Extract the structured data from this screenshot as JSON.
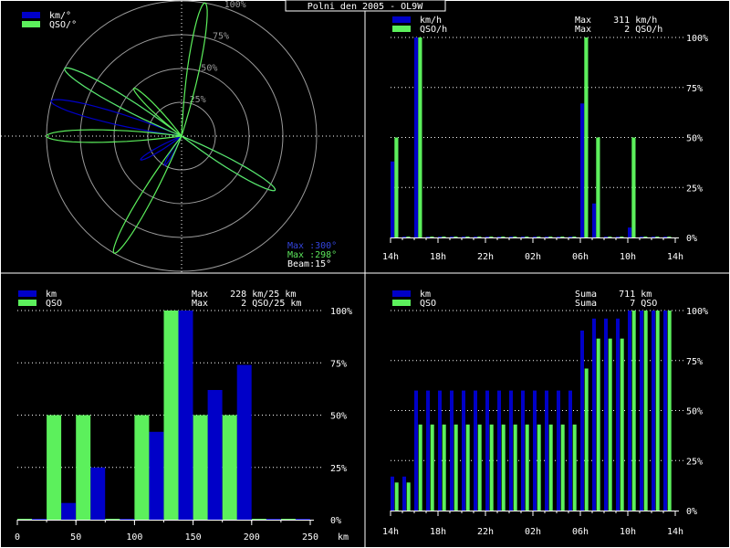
{
  "title": "Polni den 2005 - OL9W",
  "colors": {
    "background": "#000000",
    "km": "#0000c8",
    "qso": "#5cf05c",
    "grid": "#ffffff",
    "border": "#ffffff",
    "polar_ring": "#9a9a9a"
  },
  "chart_data": [
    {
      "id": "polar",
      "type": "polar",
      "legend": [
        {
          "label": "km/°",
          "color": "#0000c8"
        },
        {
          "label": "QSO/°",
          "color": "#5cf05c"
        }
      ],
      "ring_labels": [
        "25%",
        "50%",
        "75%",
        "100%"
      ],
      "angle_step_deg": 15,
      "series": [
        {
          "name": "km/°",
          "color": "#0000c8",
          "angles_deg": [
            120,
            210,
            240,
            285,
            300
          ],
          "values_pct": [
            80,
            25,
            35,
            100,
            100
          ],
          "max_deg": 300
        },
        {
          "name": "QSO/°",
          "color": "#5cf05c",
          "angles_deg": [
            10,
            120,
            210,
            270,
            300,
            315
          ],
          "values_pct": [
            100,
            80,
            100,
            100,
            100,
            50
          ],
          "max_deg": 298
        }
      ],
      "notes": {
        "max_km": "Max :300°",
        "max_qso": "Max :298°",
        "beam": "Beam:15°"
      }
    },
    {
      "id": "rate_time",
      "type": "bar",
      "legend": [
        {
          "label": "km/h",
          "color": "#0000c8"
        },
        {
          "label": "QSO/h",
          "color": "#5cf05c"
        }
      ],
      "max_labels": [
        "Max    311 km/h",
        "Max      2 QSO/h"
      ],
      "x_tick_labels": [
        "14h",
        "18h",
        "22h",
        "02h",
        "06h",
        "10h",
        "14h"
      ],
      "x_start_hour": 14,
      "x_hours": 24,
      "y_tick_labels": [
        "0%",
        "25%",
        "50%",
        "75%",
        "100%"
      ],
      "series": [
        {
          "name": "km/h",
          "values_pct": [
            38,
            0,
            100,
            0,
            0,
            0,
            0,
            0,
            0,
            0,
            0,
            0,
            0,
            0,
            0,
            0,
            67,
            17,
            0,
            0,
            5,
            0,
            0,
            0
          ]
        },
        {
          "name": "QSO/h",
          "values_pct": [
            50,
            0,
            100,
            0,
            0,
            0,
            0,
            0,
            0,
            0,
            0,
            0,
            0,
            0,
            0,
            0,
            100,
            50,
            0,
            0,
            50,
            0,
            0,
            0
          ]
        }
      ]
    },
    {
      "id": "distance_hist",
      "type": "bar",
      "legend": [
        {
          "label": "km",
          "color": "#0000c8"
        },
        {
          "label": "QSO",
          "color": "#5cf05c"
        }
      ],
      "max_labels": [
        "Max    228 km/25 km",
        "Max      2 QSO/25 km"
      ],
      "x_tick_values": [
        0,
        50,
        100,
        150,
        200,
        250
      ],
      "x_unit": "km",
      "bin_km": 25,
      "y_tick_labels": [
        "0%",
        "25%",
        "50%",
        "75%",
        "100%"
      ],
      "series": [
        {
          "name": "km",
          "values_pct": [
            0,
            8,
            25,
            0,
            42,
            100,
            62,
            74,
            0,
            0
          ]
        },
        {
          "name": "QSO",
          "values_pct": [
            0,
            50,
            50,
            0,
            50,
            100,
            50,
            50,
            0,
            0
          ]
        }
      ]
    },
    {
      "id": "cumulative",
      "type": "bar",
      "legend": [
        {
          "label": "km",
          "color": "#0000c8"
        },
        {
          "label": "QSO",
          "color": "#5cf05c"
        }
      ],
      "max_labels": [
        "Suma    711 km",
        "Suma      7 QSO"
      ],
      "x_tick_labels": [
        "14h",
        "18h",
        "22h",
        "02h",
        "06h",
        "10h",
        "14h"
      ],
      "x_start_hour": 14,
      "x_hours": 24,
      "y_tick_labels": [
        "0%",
        "25%",
        "50%",
        "75%",
        "100%"
      ],
      "series": [
        {
          "name": "km",
          "values_pct": [
            17,
            17,
            60,
            60,
            60,
            60,
            60,
            60,
            60,
            60,
            60,
            60,
            60,
            60,
            60,
            60,
            90,
            96,
            96,
            96,
            100,
            100,
            100,
            100
          ]
        },
        {
          "name": "QSO",
          "values_pct": [
            14,
            14,
            43,
            43,
            43,
            43,
            43,
            43,
            43,
            43,
            43,
            43,
            43,
            43,
            43,
            43,
            71,
            86,
            86,
            86,
            100,
            100,
            100,
            100
          ]
        }
      ]
    }
  ]
}
